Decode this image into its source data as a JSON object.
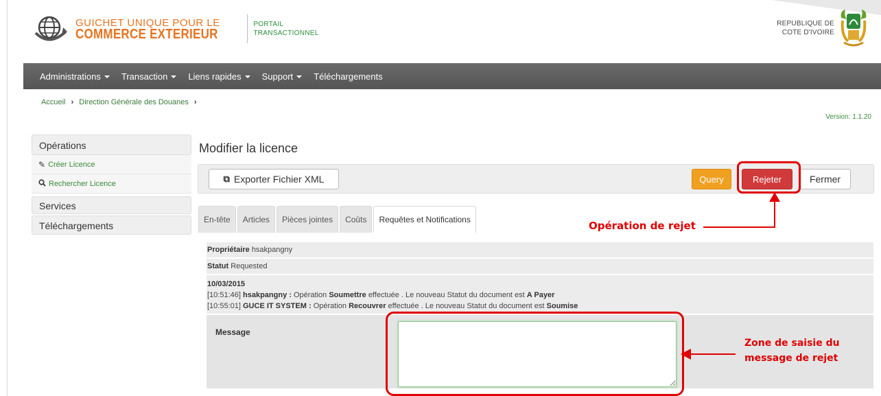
{
  "header": {
    "logo_line1": "GUICHET UNIQUE POUR LE",
    "logo_line2": "COMMERCE EXTERIEUR",
    "portal_line1": "PORTAIL",
    "portal_line2": "TRANSACTIONNEL",
    "country_line1": "REPUBLIQUE DE",
    "country_line2": "COTE D'IVOIRE"
  },
  "nav": {
    "items": [
      "Administrations",
      "Transaction",
      "Liens rapides",
      "Support",
      "Téléchargements"
    ]
  },
  "breadcrumb": [
    "Accueil",
    "Direction Générale des Douanes"
  ],
  "version": "Version: 1.1.20",
  "sidebar": {
    "operations": "Opérations",
    "create": "Créer Licence",
    "search": "Rechercher Licence",
    "services": "Services",
    "downloads": "Téléchargements"
  },
  "page_title": "Modifier la licence",
  "toolbar": {
    "export": "Exporter Fichier XML",
    "query": "Query",
    "reject": "Rejeter",
    "close": "Fermer"
  },
  "tabs": [
    "En-tête",
    "Articles",
    "Pièces jointes",
    "Coûts",
    "Requêtes et Notifications"
  ],
  "info": {
    "owner_label": "Propriétaire",
    "owner_value": "hsakpangny",
    "status_label": "Statut",
    "status_value": "Requested",
    "date": "10/03/2015",
    "log1_time": "[10:51:46]",
    "log1_user": "hsakpangny :",
    "log1_a": "Opération",
    "log1_op": "Soumettre",
    "log1_b": "effectuée . Le nouveau Statut du document est",
    "log1_status": "A Payer",
    "log2_time": "[10:55:01]",
    "log2_user": "GUCE IT SYSTEM :",
    "log2_a": "Opération",
    "log2_op": "Recouvrer",
    "log2_b": "effectuée . Le nouveau Statut du document est",
    "log2_status": "Soumise"
  },
  "message_label": "Message",
  "annotations": {
    "reject_op": "Opération de rejet",
    "msg_zone_1": "Zone de saisie du",
    "msg_zone_2": "message de rejet"
  },
  "colors": {
    "accent_orange": "#e8731f",
    "annotation_red": "#e00000",
    "link_green": "#3a8a3a"
  }
}
